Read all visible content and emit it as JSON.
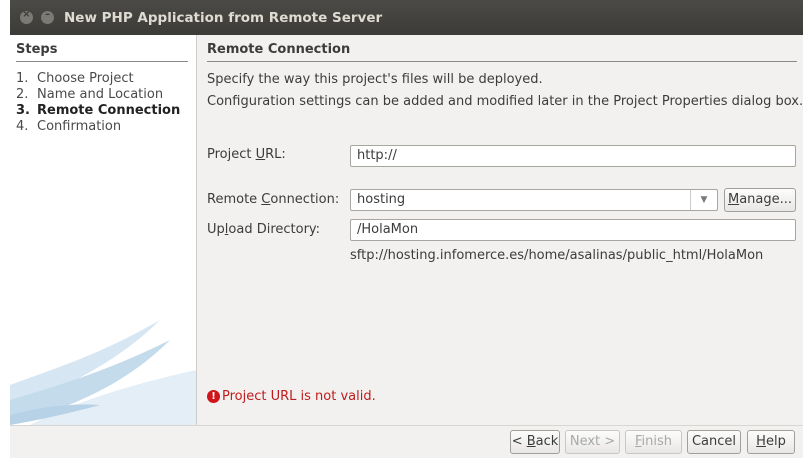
{
  "window": {
    "title": "New PHP Application from Remote Server"
  },
  "steps": {
    "heading": "Steps",
    "items": [
      {
        "num": "1.",
        "label": "Choose Project"
      },
      {
        "num": "2.",
        "label": "Name and Location"
      },
      {
        "num": "3.",
        "label": "Remote Connection",
        "active": true
      },
      {
        "num": "4.",
        "label": "Confirmation"
      }
    ]
  },
  "main": {
    "heading": "Remote Connection",
    "description_1": "Specify the way this project's files will be deployed.",
    "description_2": "Configuration settings can be added and modified later in the Project Properties dialog box.",
    "project_url": {
      "label_pre": "Project ",
      "label_mn": "U",
      "label_post": "RL:",
      "value": "http://"
    },
    "remote_connection": {
      "label_pre": "Remote ",
      "label_mn": "C",
      "label_post": "onnection:",
      "value": "hosting",
      "manage_pre": "",
      "manage_mn": "M",
      "manage_post": "anage..."
    },
    "upload_directory": {
      "label_pre": "Up",
      "label_mn": "l",
      "label_post": "oad Directory:",
      "value": "/HolaMon"
    },
    "remote_path": "sftp://hosting.infomerce.es/home/asalinas/public_html/HolaMon",
    "error": "Project URL is not valid."
  },
  "footer": {
    "back_pre": "< ",
    "back_mn": "B",
    "back_post": "ack",
    "next_label": "Next >",
    "finish_mn": "F",
    "finish_post": "inish",
    "cancel_label": "Cancel",
    "help_mn": "H",
    "help_post": "elp"
  },
  "colors": {
    "titlebar": "#3c3b37",
    "dialog_bg": "#f2f1f0",
    "error": "#c01b1b"
  }
}
